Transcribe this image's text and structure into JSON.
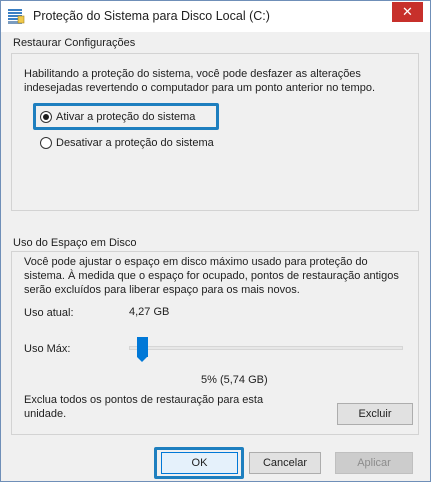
{
  "window": {
    "title": "Proteção do Sistema para Disco Local (C:)",
    "close_glyph": "✕",
    "app_icon": "system-protection-icon"
  },
  "restore": {
    "section_title": "Restaurar Configurações",
    "description": "Habilitando a proteção do sistema, você pode desfazer as alterações indesejadas revertendo o computador para um ponto anterior no tempo.",
    "options": [
      {
        "label": "Ativar a proteção do sistema",
        "selected": true
      },
      {
        "label": "Desativar a proteção do sistema",
        "selected": false
      }
    ]
  },
  "disk_usage": {
    "section_title": "Uso do Espaço em Disco",
    "description": "Você pode ajustar o espaço em disco máximo usado para proteção do sistema. À medida que o espaço for ocupado, pontos de restauração antigos serão excluídos para liberar espaço para os mais novos.",
    "current_label": "Uso atual:",
    "current_value": "4,27 GB",
    "max_label": "Uso Máx:",
    "max_value_text": "5% (5,74 GB)",
    "max_percent": 5,
    "delete_text": "Exclua todos os pontos de restauração para esta unidade.",
    "delete_button": "Excluir"
  },
  "footer": {
    "ok": "OK",
    "cancel": "Cancelar",
    "apply": "Aplicar"
  },
  "colors": {
    "highlight": "#1e7fbf",
    "slider_accent": "#0078d7",
    "close_button": "#c7302b"
  }
}
